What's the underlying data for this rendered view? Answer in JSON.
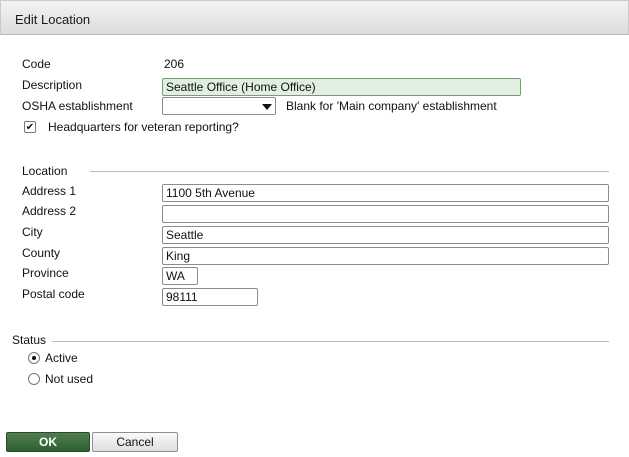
{
  "dialog": {
    "title": "Edit Location"
  },
  "fields": {
    "code": {
      "label": "Code",
      "value": "206"
    },
    "description": {
      "label": "Description",
      "value": "Seattle Office (Home Office)"
    },
    "osha": {
      "label": "OSHA establishment",
      "value": "",
      "hint": "Blank for 'Main company' establishment"
    },
    "headquarters": {
      "label": "Headquarters for veteran reporting?",
      "checked": true
    }
  },
  "location": {
    "section_label": "Location",
    "address1": {
      "label": "Address 1",
      "value": "1100 5th Avenue"
    },
    "address2": {
      "label": "Address 2",
      "value": ""
    },
    "city": {
      "label": "City",
      "value": "Seattle"
    },
    "county": {
      "label": "County",
      "value": "King"
    },
    "province": {
      "label": "Province",
      "value": "WA"
    },
    "postal": {
      "label": "Postal code",
      "value": "98111"
    }
  },
  "status": {
    "section_label": "Status",
    "options": [
      {
        "label": "Active",
        "selected": true
      },
      {
        "label": "Not used",
        "selected": false
      }
    ]
  },
  "buttons": {
    "ok": "OK",
    "cancel": "Cancel"
  },
  "icons": {
    "select_arrow": "chevron-down-icon",
    "check": "checkmark-icon"
  }
}
